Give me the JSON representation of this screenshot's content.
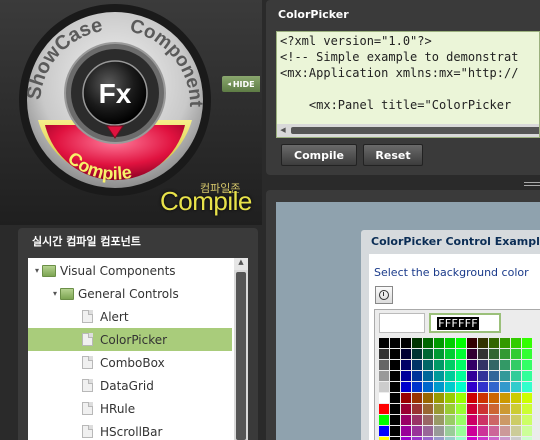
{
  "logo": {
    "ring_left": "ShowCase",
    "ring_right": "Component",
    "center": "Fx",
    "ring_bottom": "Compile",
    "caption_korean": "컴파일존",
    "caption": "Compile",
    "hide_label": "HIDE",
    "hide_arrow": "◂"
  },
  "tree": {
    "title": "실시간 컴파일 컴포넌트",
    "items": [
      {
        "label": "Visual Components",
        "twisty": "▾"
      },
      {
        "label": "General Controls",
        "twisty": "▾"
      },
      {
        "label": "Alert"
      },
      {
        "label": "ColorPicker"
      },
      {
        "label": "ComboBox"
      },
      {
        "label": "DataGrid"
      },
      {
        "label": "HRule"
      },
      {
        "label": "HScrollBar"
      }
    ],
    "selected_index": 3
  },
  "code": {
    "title": "ColorPicker",
    "lines": [
      "<?xml version=\"1.0\"?>",
      "<!-- Simple example to demonstrat",
      "<mx:Application xmlns:mx=\"http://",
      "",
      "    <mx:Panel title=\"ColorPicker"
    ],
    "compile_button": "Compile",
    "reset_button": "Reset"
  },
  "example": {
    "title": "ColorPicker Control Example",
    "instruction": "Select the background color",
    "hex_value": "FFFFFF"
  },
  "colors": {
    "accent_green": "#a9cc7b",
    "compile_text": "#e8e24a",
    "code_bg": "#ebf5d8"
  }
}
